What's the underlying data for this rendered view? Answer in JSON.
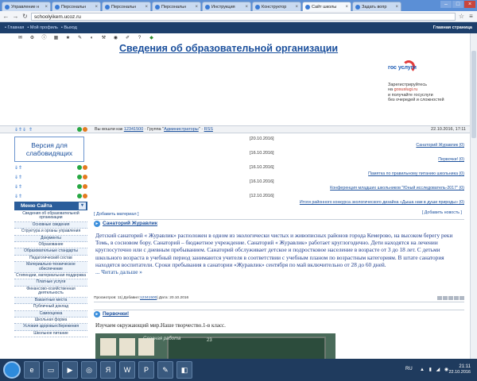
{
  "browser": {
    "tabs": [
      {
        "label": "Управление н",
        "active": false
      },
      {
        "label": "Персональн",
        "active": false
      },
      {
        "label": "Персональн",
        "active": false
      },
      {
        "label": "Персональн",
        "active": false
      },
      {
        "label": "Инструкция",
        "active": false
      },
      {
        "label": "Конструктор",
        "active": false
      },
      {
        "label": "Сайт школы",
        "active": true
      },
      {
        "label": "Задать вопр",
        "active": false
      }
    ],
    "url": "schoolyikem.ucoz.ru"
  },
  "site_bar": {
    "links": [
      "• Главная",
      "• Мой профиль",
      "• Выход"
    ],
    "right": "Главная страница"
  },
  "header": {
    "title": "Сведения  об образовательной организации",
    "gos_brand": "гос услуги",
    "gos_text1": "Зарегистрируйтесь",
    "gos_text2": "на",
    "gos_link": "gosuslugi.ru",
    "gos_text3": "и получайте госуслуги",
    "gos_text4": "без очередей и сложностей"
  },
  "info_bar": {
    "text_prefix": "Вы вошли как ",
    "user": "12341500",
    "text_group": " · Группа \"",
    "group": "Администраторы",
    "text_suffix": "\" · ",
    "rss": "RSS",
    "date": "22.10.2016, 17:11"
  },
  "sidebar": {
    "vision_label": "Версия для слабовидящих",
    "menu_title": "Меню Сайта",
    "menu_items": [
      "Сведения об образовательной организации",
      "Основные сведения",
      "Структура и органы управления",
      "Документы",
      "Образование",
      "Образовательные стандарты",
      "Педагогический состав",
      "Материально-техническое обеспечение",
      "Стипендии, материальная поддержка",
      "Платные услуги",
      "Финансово-хозяйственная деятельность",
      "Вакантные места",
      "Публичный доклад",
      "Самооценка",
      "Школьная форма",
      "Условия здоровьесбережения",
      "Школьное питание"
    ]
  },
  "news": [
    {
      "date": "[20.10.2016]",
      "title": "Санаторий Журавлик",
      "count": "(0)"
    },
    {
      "date": "[16.10.2016]",
      "title": "Первочки!",
      "count": "(0)"
    },
    {
      "date": "[16.10.2016]",
      "title": "Памятка по правильному питанию школьника",
      "count": "(0)"
    },
    {
      "date": "[16.10.2016]",
      "title": "Конференция младших школьников \"Юный исследователь-2017\"",
      "count": "(0)"
    },
    {
      "date": "[12.10.2016]",
      "title": "Итоги районного конкурса экологического дизайна «Дыша нам в души природы»",
      "count": "(0)"
    }
  ],
  "add_news": "[ Добавить новость ]",
  "add_material": "[ Добавить материал ]",
  "article1": {
    "title": "Санаторий Журавлик",
    "body": "Детский санаторий « Журавлик» расположен в одном из экологически чистых и живописных районов города Кемерово, на высоком берегу реки Томь, в сосновом бору. Санаторий – бюджетное учреждение. Санаторий « Журавлик» работает круглогодично. Дети находятся на лечении круглосуточно или с дневным пребыванием. Санаторий обслуживает детское и подростковое население в возрасте от 3 до 18 лет. С детьми школьного возраста в учебный период занимаются учителя в соответствии с учебным планом по возрастным категориям. В штате санатория находятся воспитатели. Сроки пребывания в санатории «Журавлик» сентября по май включительно от 28 до 60 дней.",
    "more": "... Читать дальше »",
    "meta_views": "Просмотров: 11",
    "meta_added": " | Добавил: ",
    "meta_user": "12341500",
    "meta_date": " | Дата: 20.10.2016"
  },
  "article2": {
    "title": "Первочки!",
    "body": "Изучаем окружающий мир.Наше творчество.1-в класс.",
    "board_text": "Славная работа",
    "board_num": "23"
  },
  "taskbar": {
    "lang": "RU",
    "time": "21:11",
    "date": "22.10.2016"
  },
  "colors": {
    "site_bar": "#1d3f6b",
    "link": "#1a4f9c",
    "gos_red": "#e23b3b",
    "gos_blue": "#1c5bb5",
    "taskbar": "#1f3b5e"
  }
}
